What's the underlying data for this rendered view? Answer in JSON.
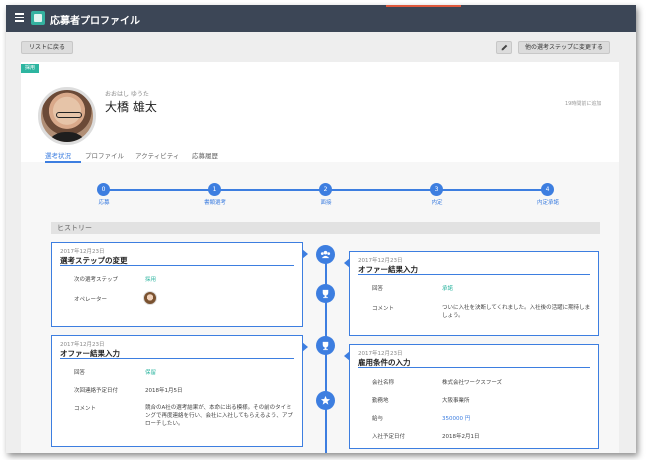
{
  "app": {
    "title": "応募者プロファイル"
  },
  "toolbar": {
    "back_label": "リストに戻る",
    "change_step_label": "他の選考ステップに変更する"
  },
  "applicant": {
    "status_tag": "採用",
    "furigana": "おおはし ゆうた",
    "name": "大橋 雄太",
    "updated": "19時間前に追加"
  },
  "tabs": [
    "選考状況",
    "プロファイル",
    "アクティビティ",
    "応募履歴"
  ],
  "active_tab": "選考状況",
  "steps": [
    {
      "num": "0",
      "label": "応募"
    },
    {
      "num": "1",
      "label": "書類選考"
    },
    {
      "num": "2",
      "label": "面接"
    },
    {
      "num": "3",
      "label": "内定"
    },
    {
      "num": "4",
      "label": "内定承諾"
    }
  ],
  "history": {
    "label": "ヒストリー",
    "events": [
      {
        "date": "2017年12月23日",
        "title": "選考ステップの変更",
        "fields": [
          {
            "key": "次の選考ステップ",
            "value": "採用"
          },
          {
            "key": "オペレーター",
            "value": ""
          }
        ]
      },
      {
        "date": "2017年12月23日",
        "title": "オファー結果入力",
        "fields": [
          {
            "key": "回答",
            "value": "承諾"
          },
          {
            "key": "コメント",
            "value": "ついに入社を決断してくれました。入社後の活躍に期待しましょう。"
          }
        ]
      },
      {
        "date": "2017年12月23日",
        "title": "オファー結果入力",
        "fields": [
          {
            "key": "回答",
            "value": "保留"
          },
          {
            "key": "次回連絡予定日付",
            "value": "2018年1月5日"
          },
          {
            "key": "コメント",
            "value": "競合のA社の選考結果が、本命に出る模様。その前のタイミングで再度連絡を行い、会社に入社してもらえるよう、アプローチしたい。"
          }
        ]
      },
      {
        "date": "2017年12月23日",
        "title": "雇用条件の入力",
        "fields": [
          {
            "key": "会社名称",
            "value": "株式会社ワークスフーズ"
          },
          {
            "key": "勤務地",
            "value": "大阪事業所"
          },
          {
            "key": "給与",
            "value": "350000 円"
          },
          {
            "key": "入社予定日付",
            "value": "2018年2月1日"
          }
        ]
      }
    ]
  },
  "colors": {
    "accent": "#3d7ee0",
    "teal": "#2db5a0",
    "topbar": "#3c4656"
  },
  "icons": [
    "menu-icon",
    "pencil-icon",
    "group-icon",
    "trophy-icon",
    "star-icon"
  ]
}
